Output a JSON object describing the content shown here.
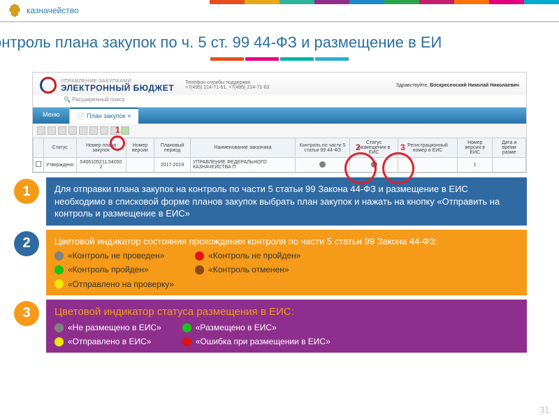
{
  "topbar_colors": [
    "#e84e1b",
    "#e6a817",
    "#2db29b",
    "#8e2f8e",
    "#1d8acb",
    "#2aa54a",
    "#c31f6e",
    "#ff7200",
    "#e6007e",
    "#00aacb"
  ],
  "mini_colors": [
    "#e84e1b",
    "#e6007e",
    "#00b3a0",
    "#2db0d6"
  ],
  "header": {
    "org": "казначейство"
  },
  "heading": "онтроль плана закупок по ч. 5 ст. 99 44-ФЗ и размещение в ЕИ",
  "app": {
    "sub": "УПРАВЛЕНИЕ ЗАКУПКАМИ",
    "main": "ЭЛЕКТРОННЫЙ БЮДЖЕТ",
    "phone_label": "Телефон службы поддержки",
    "phones": "+7(495) 214-71-61, +7(495) 214-71-63",
    "search": "🔍 Расширенный поиск",
    "greeting_label": "Здравствуйте, ",
    "greeting_user": "Воскресенский Николай Николаевич",
    "menu_btn": "Меню",
    "tab_label": "План закупок",
    "columns": {
      "col_status": "Статус",
      "col_plan_no": "Номер плана закупок",
      "col_ver": "Номер версии",
      "col_period": "Плановый период",
      "col_customer": "Наименование заказчика",
      "col_ctrl": "Контроль по части 5 статьи 99 44-ФЗ",
      "col_eis_status": "Статус размещения в ЕИС",
      "col_reg": "Регистрационный номер в ЕИС",
      "col_eis_ver": "Номер версии в ЕИС",
      "col_date": "Дата и время разме"
    },
    "row": {
      "status": "Утверждено",
      "plan_no": "5406105211.54050 2",
      "ver": "",
      "period": "2017-2019",
      "customer": "УПРАВЛЕНИЕ ФЕДЕРАЛЬНОГО КАЗНАЧЕЙСТВА П",
      "reg": "",
      "eis_ver": "1",
      "date": ""
    },
    "ann1": "1",
    "ann2": "2",
    "ann3": "3"
  },
  "step1": {
    "num": "1",
    "text": "Для отправки плана закупок на контроль по части 5 статьи 99 Закона 44-ФЗ и размещение в ЕИС необходимо в списковой форме планов закупок выбрать план закупок и нажать на кнопку        «Отправить на контроль и размещение в ЕИС»",
    "badge": "#f59a19",
    "bg": "#2f6aa3"
  },
  "step2": {
    "num": "2",
    "title": "Цветовой индикатор состояния прохождения контроля по части 5 статьи 99 Закона 44-ФЗ:",
    "badge": "#2f6aa3",
    "bg": "#f59a19",
    "left": [
      {
        "color": "#808080",
        "label": "«Контроль не проведен»"
      },
      {
        "color": "#19c419",
        "label": "«Контроль пройден»"
      },
      {
        "color": "#f2e600",
        "label": "«Отправлено на проверку»"
      }
    ],
    "right": [
      {
        "color": "#e11212",
        "label": "«Контроль не пройден»"
      },
      {
        "color": "#8a4a12",
        "label": "«Контроль отменен»"
      }
    ]
  },
  "step3": {
    "num": "3",
    "title": "Цветовой индикатор статуса размещения в ЕИС:",
    "badge": "#f59a19",
    "bg": "#8e2f8e",
    "left": [
      {
        "color": "#808080",
        "label": "«Не размещено  в ЕИС»"
      },
      {
        "color": "#f2e600",
        "label": "«Отправлено в ЕИС»"
      }
    ],
    "right": [
      {
        "color": "#19c419",
        "label": "«Размещено в ЕИС»"
      },
      {
        "color": "#e11212",
        "label": "«Ошибка при размещении в ЕИС»"
      }
    ]
  },
  "page_no": "31"
}
